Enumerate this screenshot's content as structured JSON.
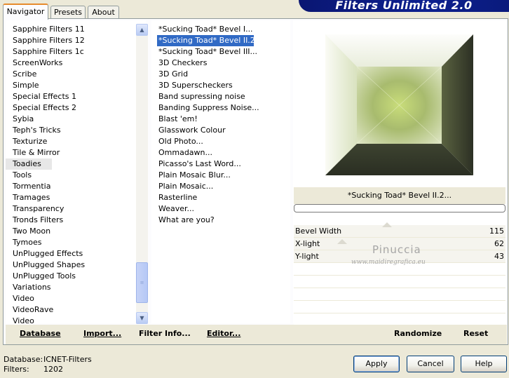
{
  "tabs": [
    "Navigator",
    "Presets",
    "About"
  ],
  "banner": "Filters Unlimited 2.0",
  "categories": [
    "Sapphire Filters 11",
    "Sapphire Filters 12",
    "Sapphire Filters 1c",
    "ScreenWorks",
    "Scribe",
    "Simple",
    "Special Effects 1",
    "Special Effects 2",
    "Sybia",
    "Teph's Tricks",
    "Texturize",
    "Tile & Mirror",
    "Toadies",
    "Tools",
    "Tormentia",
    "Tramages",
    "Transparency",
    "Tronds Filters",
    "Two Moon",
    "Tymoes",
    "UnPlugged Effects",
    "UnPlugged Shapes",
    "UnPlugged Tools",
    "Variations",
    "Video",
    "VideoRave",
    "Video"
  ],
  "selected_category": "Toadies",
  "filters": [
    "*Sucking Toad*  Bevel I...",
    "*Sucking Toad*  Bevel II.2...",
    "*Sucking Toad*  Bevel III...",
    "3D Checkers",
    "3D Grid",
    "3D Superscheckers",
    "Band supressing noise",
    "Banding Suppress Noise...",
    "Blast 'em!",
    "Glasswork Colour",
    "Old Photo...",
    "Ommadawn...",
    "Picasso's Last Word...",
    "Plain Mosaic Blur...",
    "Plain Mosaic...",
    "Rasterline",
    "Weaver...",
    "What are you?"
  ],
  "selected_filter": "*Sucking Toad*  Bevel II.2...",
  "current_filter_name": "*Sucking Toad*  Bevel II.2...",
  "params": [
    {
      "name": "Bevel Width",
      "value": "115"
    },
    {
      "name": "X-light",
      "value": "62"
    },
    {
      "name": "Y-light",
      "value": "43"
    }
  ],
  "watermark": {
    "line1": "Pinuccia",
    "line2": "www.maidiregrafica.eu"
  },
  "toolbar": {
    "database": "Database",
    "import": "Import...",
    "filter_info": "Filter Info...",
    "editor": "Editor...",
    "randomize": "Randomize",
    "reset": "Reset"
  },
  "status": {
    "database_label": "Database:",
    "database_value": "ICNET-Filters",
    "filters_label": "Filters:",
    "filters_value": "1202"
  },
  "buttons": {
    "apply": "Apply",
    "cancel": "Cancel",
    "help": "Help"
  },
  "colors": {
    "selection": "#316ac5",
    "banner": "#0d2190",
    "tab_accent": "#e68b2c"
  }
}
